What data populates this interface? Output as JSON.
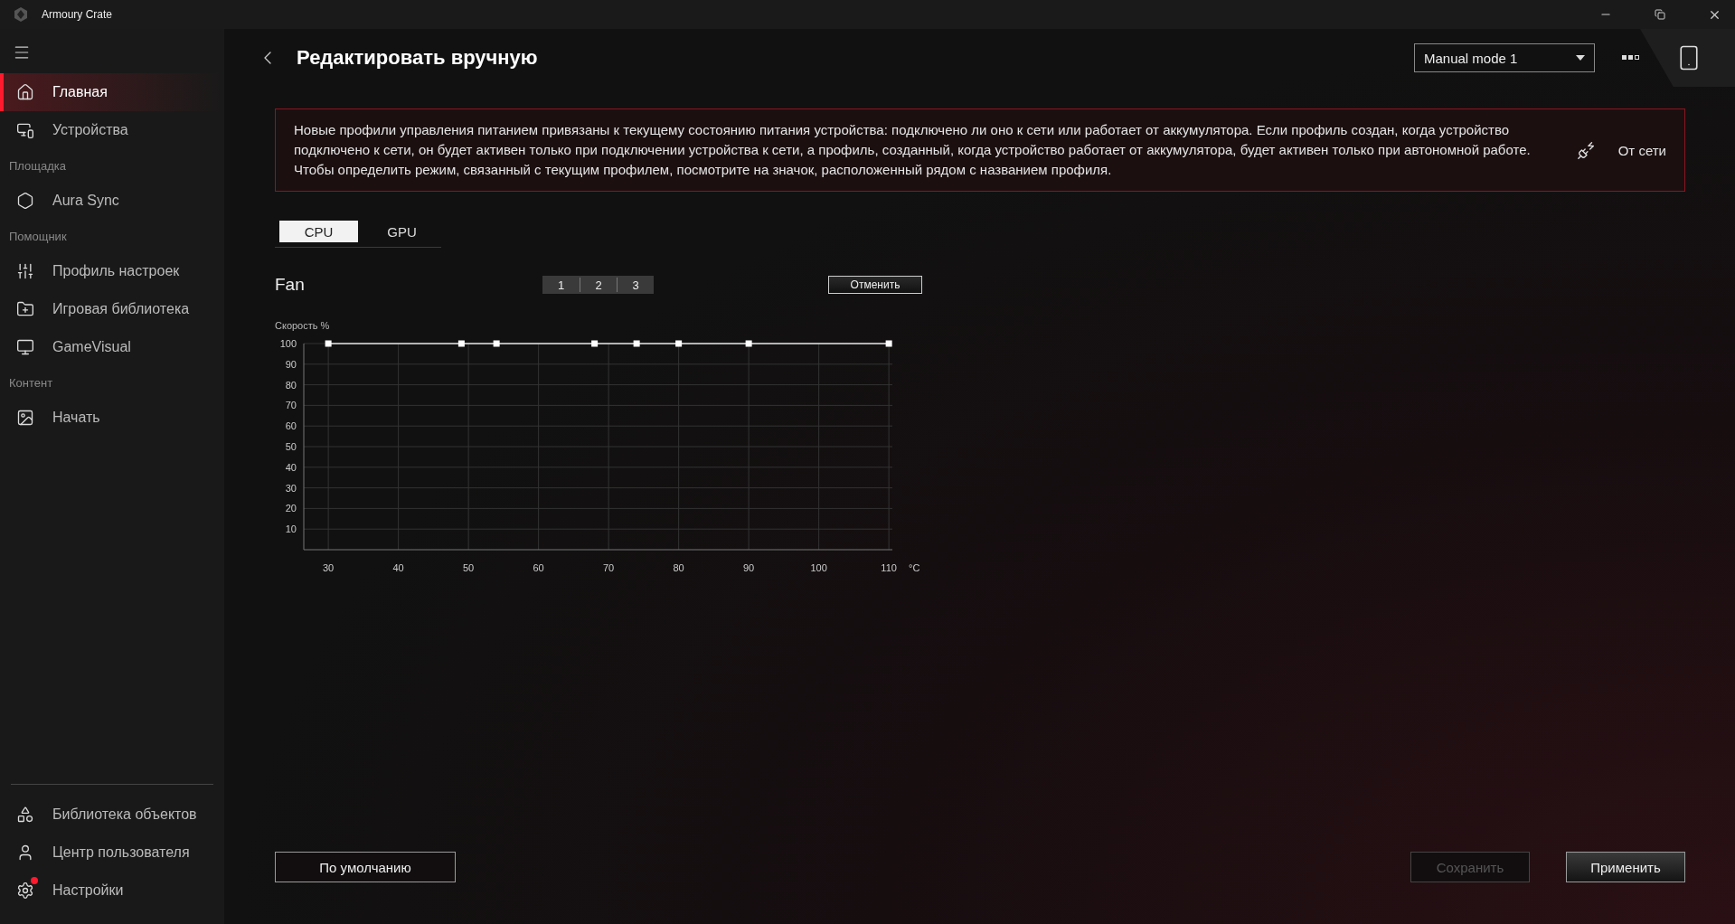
{
  "window": {
    "title": "Armoury Crate"
  },
  "sidebar": {
    "items": [
      {
        "kind": "item",
        "label": "Главная",
        "selected": true
      },
      {
        "kind": "item",
        "label": "Устройства",
        "selected": false
      },
      {
        "kind": "section",
        "label": "Площадка"
      },
      {
        "kind": "item",
        "label": "Aura Sync",
        "selected": false
      },
      {
        "kind": "section",
        "label": "Помощник"
      },
      {
        "kind": "item",
        "label": "Профиль настроек",
        "selected": false
      },
      {
        "kind": "item",
        "label": "Игровая библиотека",
        "selected": false
      },
      {
        "kind": "item",
        "label": "GameVisual",
        "selected": false
      },
      {
        "kind": "section",
        "label": "Контент"
      },
      {
        "kind": "item",
        "label": "Начать",
        "selected": false
      }
    ],
    "bottom_items": [
      {
        "label": "Библиотека объектов",
        "badge": false
      },
      {
        "label": "Центр пользователя",
        "badge": false
      },
      {
        "label": "Настройки",
        "badge": true
      }
    ]
  },
  "header": {
    "title": "Редактировать вручную",
    "profile": "Manual mode 1"
  },
  "notice": {
    "text": "Новые профили управления питанием привязаны к текущему состоянию питания устройства: подключено ли оно к сети или работает от аккумулятора. Если профиль создан, когда устройство подключено к сети, он будет активен только при подключении устройства к сети, а профиль, созданный, когда устройство работает от аккумулятора, будет активен только при автономной работе. Чтобы определить режим, связанный с текущим профилем, посмотрите на значок, расположенный рядом с названием профиля.",
    "power_mode": "От сети"
  },
  "tabs": [
    {
      "label": "CPU",
      "selected": true
    },
    {
      "label": "GPU",
      "selected": false
    }
  ],
  "fan": {
    "title": "Fan",
    "fan_tabs": [
      "1",
      "2",
      "3"
    ],
    "cancel_button": "Отменить",
    "chart_data": {
      "type": "line",
      "ylabel": "Скорость %",
      "xlabel": "°C",
      "x": [
        30,
        49,
        54,
        68,
        74,
        80,
        90,
        110
      ],
      "grid": true,
      "series": [
        {
          "color": "#e6e6e6",
          "marker": "square",
          "values": [
            100,
            100,
            100,
            100,
            100,
            100,
            100,
            100
          ]
        }
      ],
      "xlim": [
        26.5,
        110.5
      ],
      "ylim": [
        0,
        100
      ],
      "xticks": [
        30,
        40,
        50,
        60,
        70,
        80,
        90,
        100,
        110
      ],
      "yticks": [
        10,
        20,
        30,
        40,
        50,
        60,
        70,
        80,
        90,
        100
      ]
    }
  },
  "buttons": [
    {
      "kind": "default",
      "label": "По умолчанию",
      "disabled": false
    },
    {
      "kind": "save",
      "label": "Сохранить",
      "disabled": true
    },
    {
      "kind": "apply",
      "label": "Применить",
      "disabled": false
    }
  ]
}
